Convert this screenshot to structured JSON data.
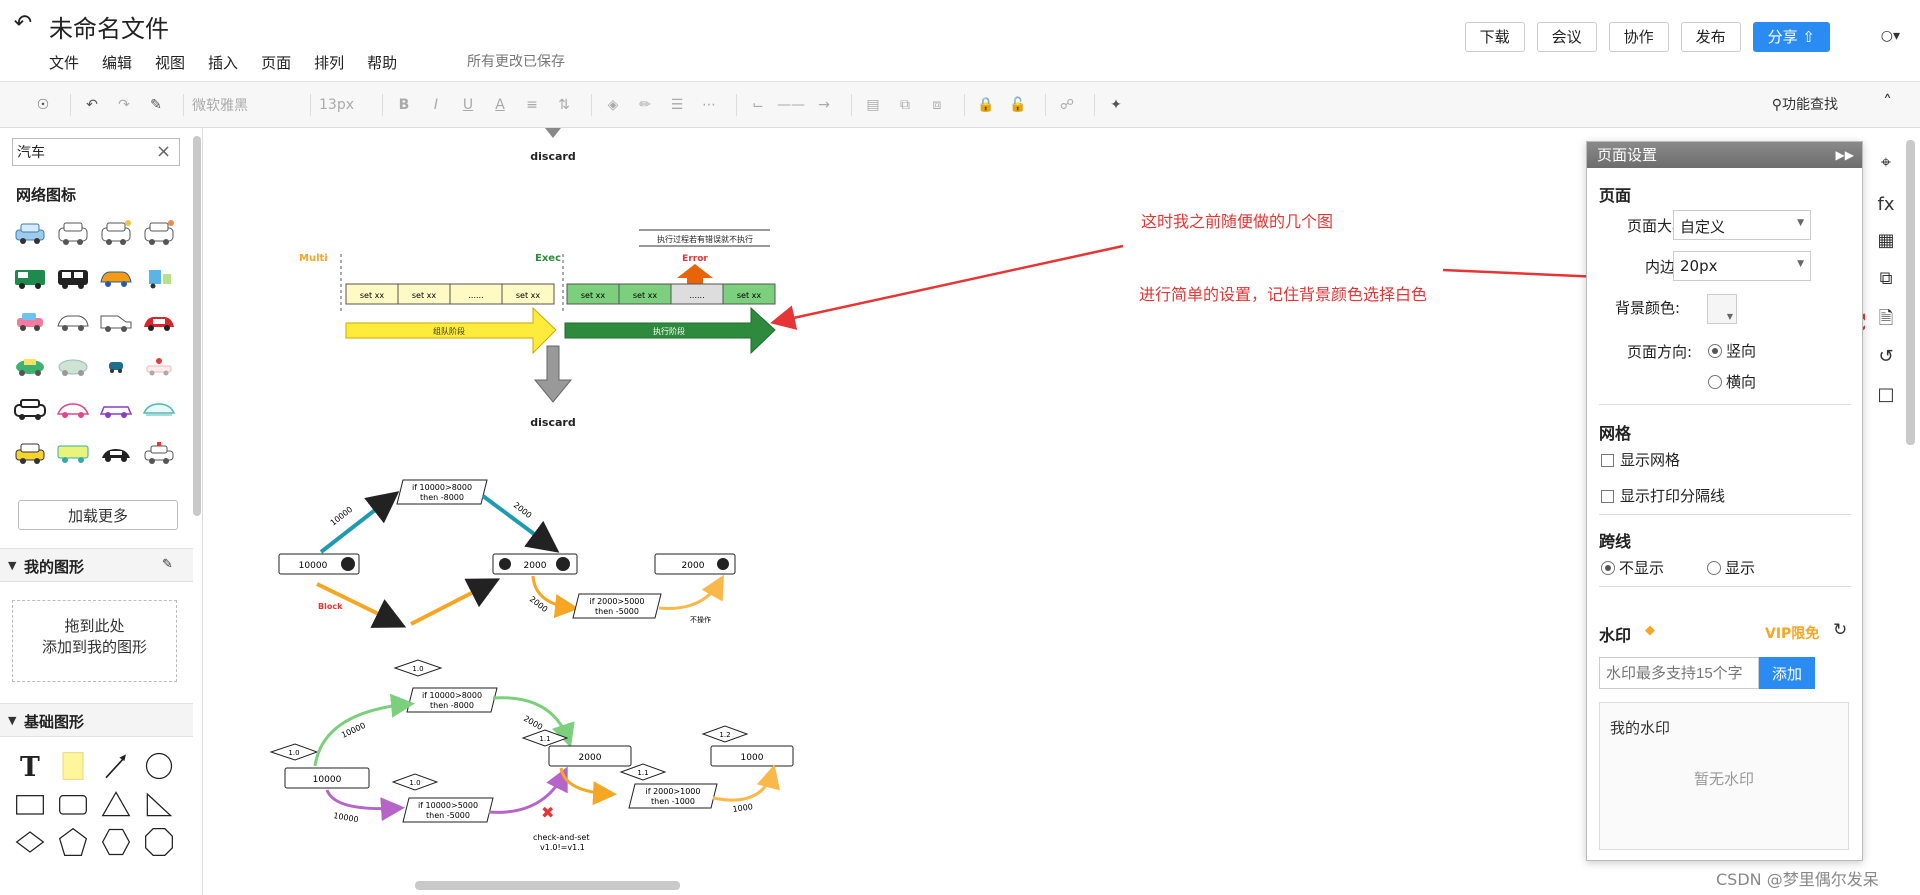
{
  "header": {
    "title": "未命名文件",
    "menus": [
      "文件",
      "编辑",
      "视图",
      "插入",
      "页面",
      "排列",
      "帮助"
    ],
    "save_status": "所有更改已保存",
    "buttons": {
      "download": "下载",
      "meeting": "会议",
      "collaborate": "协作",
      "publish": "发布",
      "share": "分享"
    },
    "user_label": "○▾"
  },
  "toolbar": {
    "font_family": "微软雅黑",
    "font_size": "13px",
    "feature_search": "功能查找"
  },
  "left_panel": {
    "search_value": "汽车",
    "network_icons_title": "网络图标",
    "load_more": "加载更多",
    "my_shapes_title": "我的图形",
    "drop_hint_1": "拖到此处",
    "drop_hint_2": "添加到我的图形",
    "basic_shapes_title": "基础图形"
  },
  "canvas": {
    "annotation_1": "这时我之前随便做的几个图",
    "annotation_2": "进行简单的设置，记住背景颜色选择白色",
    "diagram1": {
      "discard_top": "discard",
      "discard_bottom": "discard",
      "multi": "Multi",
      "exec": "Exec",
      "error": "Error",
      "note": "执行过程若有错误就不执行",
      "cells_left": [
        "set xx",
        "set xx",
        "......",
        "set xx"
      ],
      "cells_right": [
        "set xx",
        "set xx",
        "......",
        "set xx"
      ],
      "queue_stage": "组队阶段",
      "exec_stage": "执行阶段"
    },
    "diagram2": {
      "n10000": "10000",
      "n2000a": "2000",
      "n2000b": "2000",
      "cond1_l1": "if 10000>8000",
      "cond1_l2": "then -8000",
      "cond2_l1": "if 2000>5000",
      "cond2_l2": "then -5000",
      "e10000": "10000",
      "e2000a": "2000",
      "e2000b": "2000",
      "block": "Block",
      "noop": "不操作"
    },
    "diagram3": {
      "n10000": "10000",
      "n2000": "2000",
      "n1000": "1000",
      "v1": "1.0",
      "v2": "1.0",
      "v3": "1.0",
      "v4": "1.1",
      "v5": "1.1",
      "v6": "1.2",
      "c1_l1": "if 10000>8000",
      "c1_l2": "then -8000",
      "c2_l1": "if 10000>5000",
      "c2_l2": "then -5000",
      "c3_l1": "if 2000>1000",
      "c3_l2": "then -1000",
      "e1": "10000",
      "e2": "10000",
      "e3": "2000",
      "e4": "1000",
      "cas_l1": "check-and-set",
      "cas_l2": "v1.0!=v1.1"
    }
  },
  "page_settings": {
    "title": "页面设置",
    "page_section": "页面",
    "page_size_label": "页面大小:",
    "page_size_value": "自定义",
    "padding_label": "内边距:",
    "padding_value": "20px",
    "bg_label": "背景颜色:",
    "orientation_label": "页面方向:",
    "portrait": "竖向",
    "landscape": "横向",
    "grid_section": "网格",
    "show_grid": "显示网格",
    "show_print_lines": "显示打印分隔线",
    "jump_section": "跨线",
    "hide": "不显示",
    "show": "显示",
    "watermark_section": "水印",
    "vip_label": "VIP限免",
    "wm_placeholder": "水印最多支持15个字",
    "wm_add": "添加",
    "my_watermark": "我的水印",
    "no_watermark": "暂无水印"
  },
  "credit": "CSDN @梦里偶尔发呆",
  "colors": {
    "accent": "#2a8cf3",
    "annotation": "#e53535",
    "vip": "#f5a623"
  }
}
